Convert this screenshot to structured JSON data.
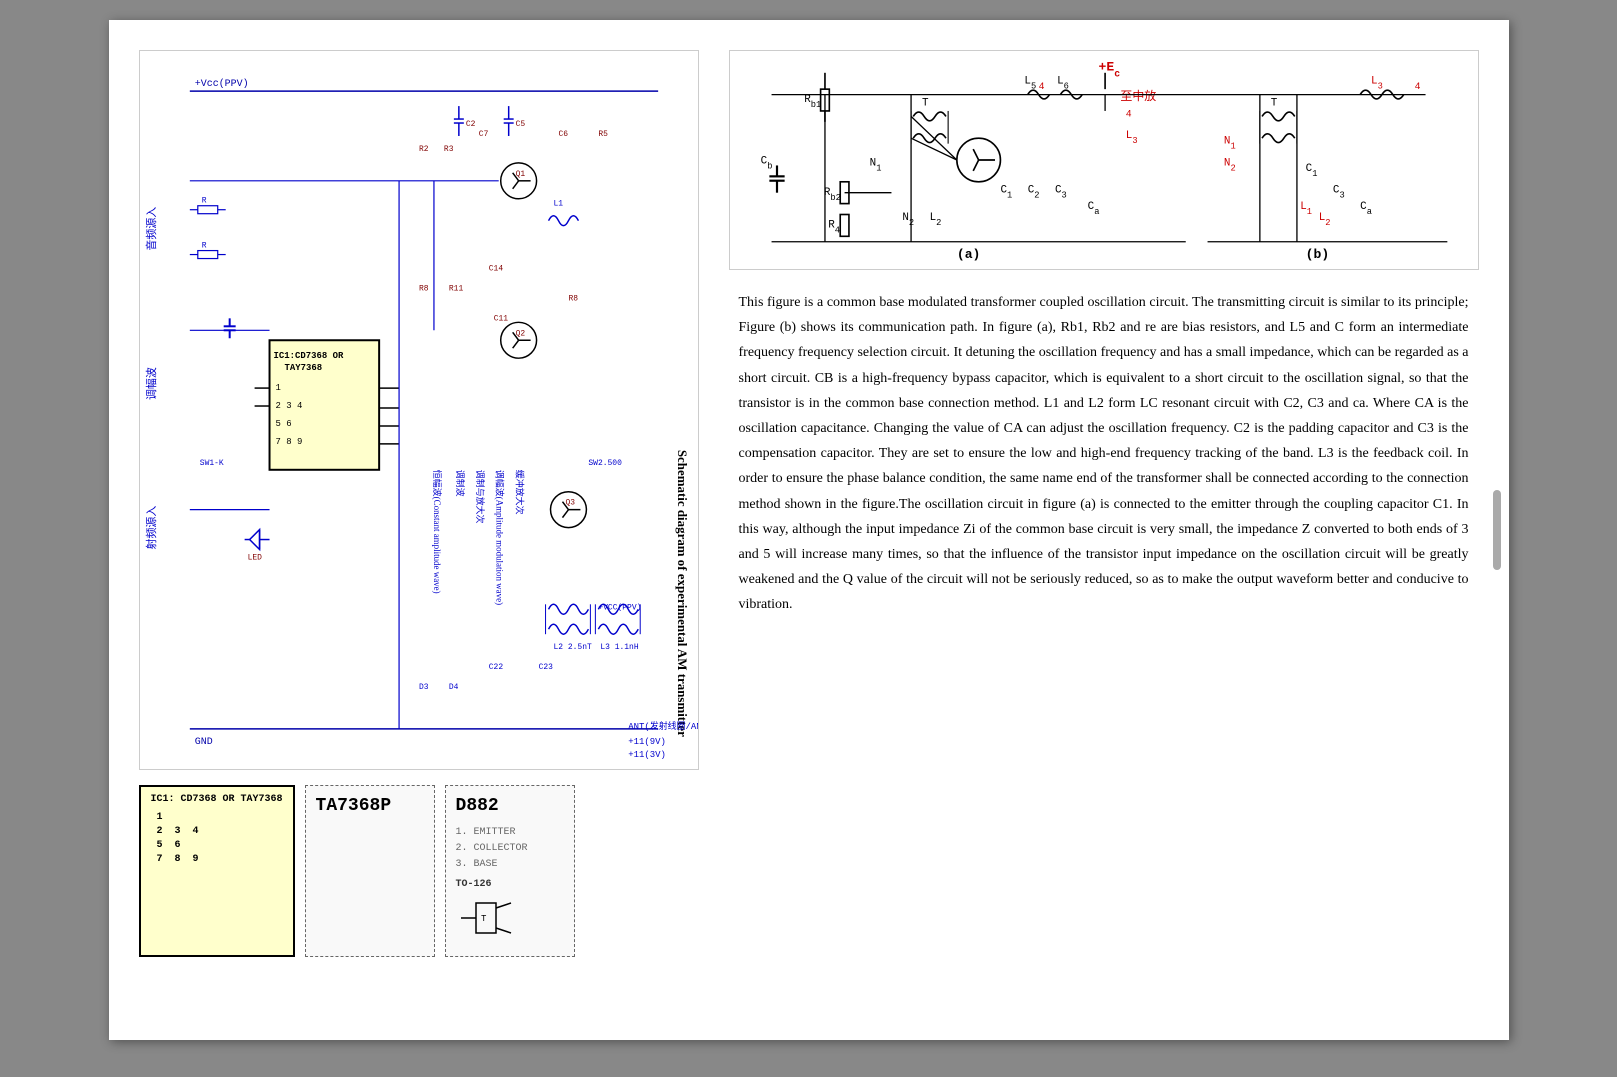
{
  "page": {
    "title": "Schematic diagram of experimental AM transmitter"
  },
  "left": {
    "circuit_title": "Schematic diagram of experimental AM transmitter",
    "ic_box": {
      "title": "IC1: CD7368 OR TAY7368",
      "pins": [
        "1",
        "2  3  4",
        "5  6",
        "7  8  9"
      ]
    },
    "ta7368p": {
      "name": "TA7368P"
    },
    "d882": {
      "name": "D882",
      "specs": [
        "1. EMITTER",
        "2. COLLECTOR",
        "3. BASE"
      ],
      "model": "TO-126"
    }
  },
  "right": {
    "circuit_labels": {
      "ec": "+Ec",
      "a_label": "(a)",
      "b_label": "(b)",
      "components": [
        "Rb1",
        "Rb2",
        "R4",
        "L5",
        "L6",
        "L3",
        "C1",
        "C2",
        "C3",
        "Ca",
        "Cb",
        "N1",
        "N2",
        "T"
      ]
    },
    "description": "This figure is a common base modulated transformer coupled oscillation circuit. The transmitting circuit is similar to its principle; Figure (b) shows its communication path. In figure (a), Rb1, Rb2 and re are bias resistors, and L5 and C form an intermediate frequency frequency selection circuit. It detuning the oscillation frequency and has a small impedance, which can be regarded as a short circuit. CB is a high-frequency bypass capacitor, which is equivalent to a short circuit to the oscillation signal, so that the transistor is in the common base connection method. L1 and L2 form LC resonant circuit with C2, C3 and ca. Where CA is the oscillation capacitance. Changing the value of CA can adjust the oscillation frequency. C2 is the padding capacitor and C3 is the compensation capacitor. They are set to ensure the low and high-end frequency tracking of the band. L3 is the feedback coil. In order to ensure the phase balance condition, the same name end of the transformer shall be connected according to the connection method shown in the figure.The oscillation circuit in figure (a) is connected to the emitter through the coupling capacitor C1. In this way, although the input impedance Zi of the common base circuit is very small, the impedance Z converted to both ends of 3 and 5 will increase many times, so that the influence of the transistor input impedance on the oscillation circuit will be greatly weakened and the Q value of the circuit will not be seriously reduced, so as to make the output waveform better and conducive to vibration."
  }
}
